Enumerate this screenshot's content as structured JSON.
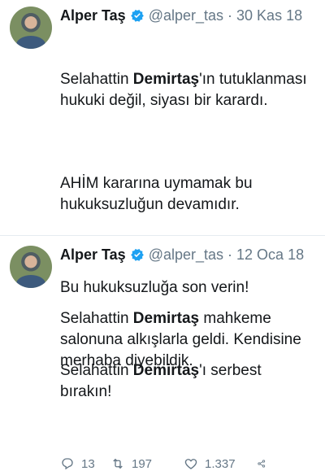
{
  "tweets": [
    {
      "name": "Alper Taş",
      "handle": "@alper_tas",
      "separator": "·",
      "date": "30 Kas 18",
      "paragraphs": [
        {
          "segments": [
            {
              "text": "Selahattin ",
              "bold": false
            },
            {
              "text": "Demirtaş",
              "bold": true
            },
            {
              "text": "'ın tutuklanması hukuki değil, siyası bir karardı.",
              "bold": false
            }
          ]
        },
        {
          "segments": [
            {
              "text": "AHİM kararına uymamak bu hukuksuzluğun devamıdır.",
              "bold": false
            }
          ]
        },
        {
          "segments": [
            {
              "text": "Bu hukuksuzluğa son verin!",
              "bold": false
            }
          ]
        },
        {
          "segments": [
            {
              "text": "Selahattin ",
              "bold": false
            },
            {
              "text": "Demirtaş",
              "bold": true
            },
            {
              "text": "'ı serbest bırakın!",
              "bold": false
            }
          ]
        }
      ],
      "stats": {
        "replies": "13",
        "retweets": "197",
        "likes": "1.337"
      }
    },
    {
      "name": "Alper Taş",
      "handle": "@alper_tas",
      "separator": "·",
      "date": "12 Oca 18",
      "paragraphs": [
        {
          "segments": [
            {
              "text": "Selahattin ",
              "bold": false
            },
            {
              "text": "Demirtaş",
              "bold": true
            },
            {
              "text": " mahkeme salonuna alkışlarla geldi. Kendisine merhaba diyebildik.",
              "bold": false
            }
          ]
        }
      ]
    }
  ],
  "colors": {
    "accent": "#1da1f2",
    "text": "#14171a",
    "muted": "#657786",
    "divider": "#e6ecf0"
  },
  "icons": [
    "verified-badge-icon",
    "reply-icon",
    "retweet-icon",
    "like-icon",
    "share-icon"
  ]
}
